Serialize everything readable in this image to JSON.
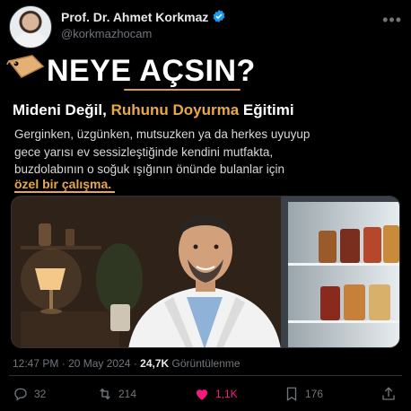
{
  "author": {
    "name": "Prof. Dr. Ahmet Korkmaz",
    "handle": "@korkmazhocam",
    "verified": true
  },
  "post": {
    "headline": "NEYE AÇSIN?",
    "subtitle_part1": "Mideni Değil, ",
    "subtitle_accent": "Ruhunu Doyurma",
    "subtitle_part2": " Eğitimi",
    "body_lines": [
      "Gerginken, üzgünken, mutsuzken ya da herkes uyuyup",
      "gece yarısı ev sessizleştiğinde kendini mutfakta,",
      "buzdolabının o soğuk ışığının önünde bulanlar için"
    ],
    "highlight": "özel bir çalışma.",
    "image_icon": "doctor-kitchen-fridge-photo"
  },
  "meta": {
    "time": "12:47 PM",
    "separator": "·",
    "date": "20 May 2024",
    "views_count": "24,7K",
    "views_label": "Görüntülenme"
  },
  "actions": {
    "replies": "32",
    "reposts": "214",
    "likes": "1,1K",
    "bookmarks": "176"
  },
  "colors": {
    "accent": "#e8a84a",
    "like": "#f91880",
    "verified": "#1d9bf0",
    "muted": "#71767b"
  }
}
